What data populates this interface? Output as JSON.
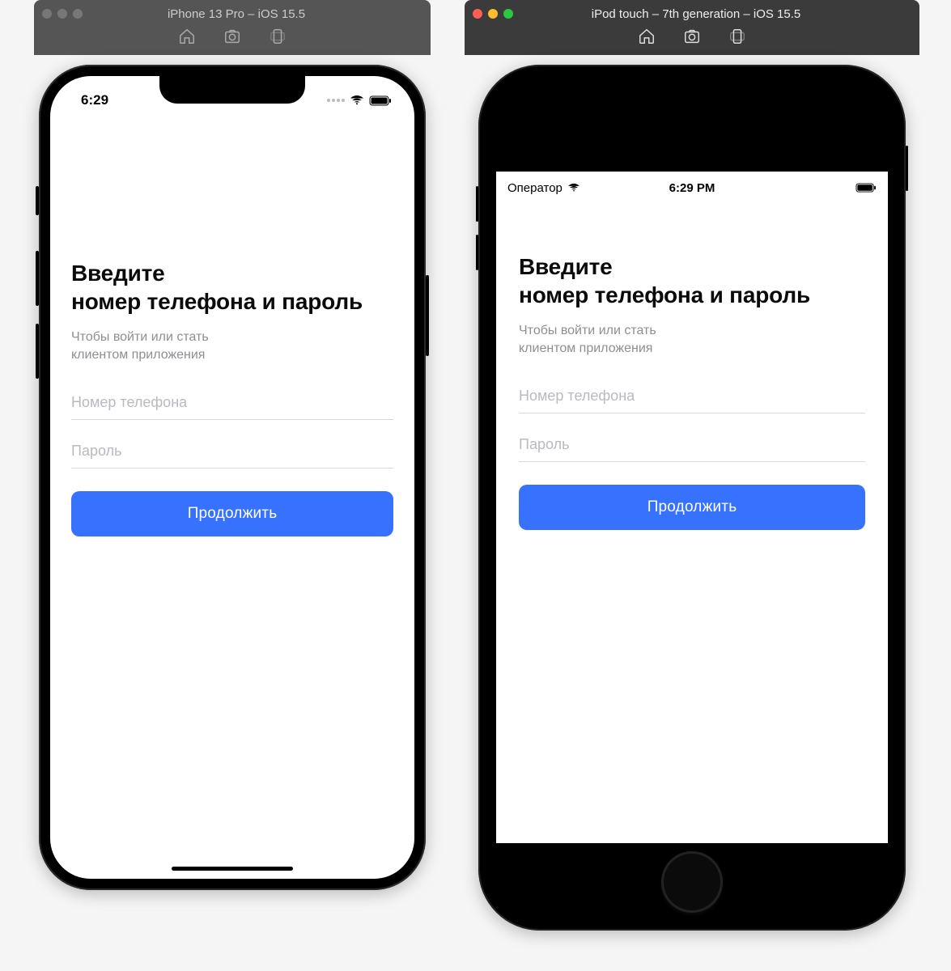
{
  "simulators": {
    "left": {
      "title": "iPhone 13 Pro – iOS 15.5",
      "active": false,
      "toolbar": [
        "home-icon",
        "screenshot-icon",
        "rotate-icon"
      ]
    },
    "right": {
      "title": "iPod touch – 7th generation – iOS 15.5",
      "active": true,
      "toolbar": [
        "home-icon",
        "screenshot-icon",
        "rotate-icon"
      ]
    }
  },
  "status": {
    "left": {
      "time": "6:29"
    },
    "right": {
      "carrier": "Оператор",
      "time": "6:29 PM"
    }
  },
  "login": {
    "title_line1": "Введите",
    "title_line2": "номер телефона и пароль",
    "title_combined": "Введите номер телефона и пароль",
    "subtitle_line1": "Чтобы войти или стать",
    "subtitle_line2": "клиентом приложения",
    "phone_placeholder": "Номер телефона",
    "password_placeholder": "Пароль",
    "continue_label": "Продолжить"
  },
  "colors": {
    "primary": "#3772ff",
    "text_secondary": "#8e8e93",
    "field_border": "#d8d8dc"
  }
}
